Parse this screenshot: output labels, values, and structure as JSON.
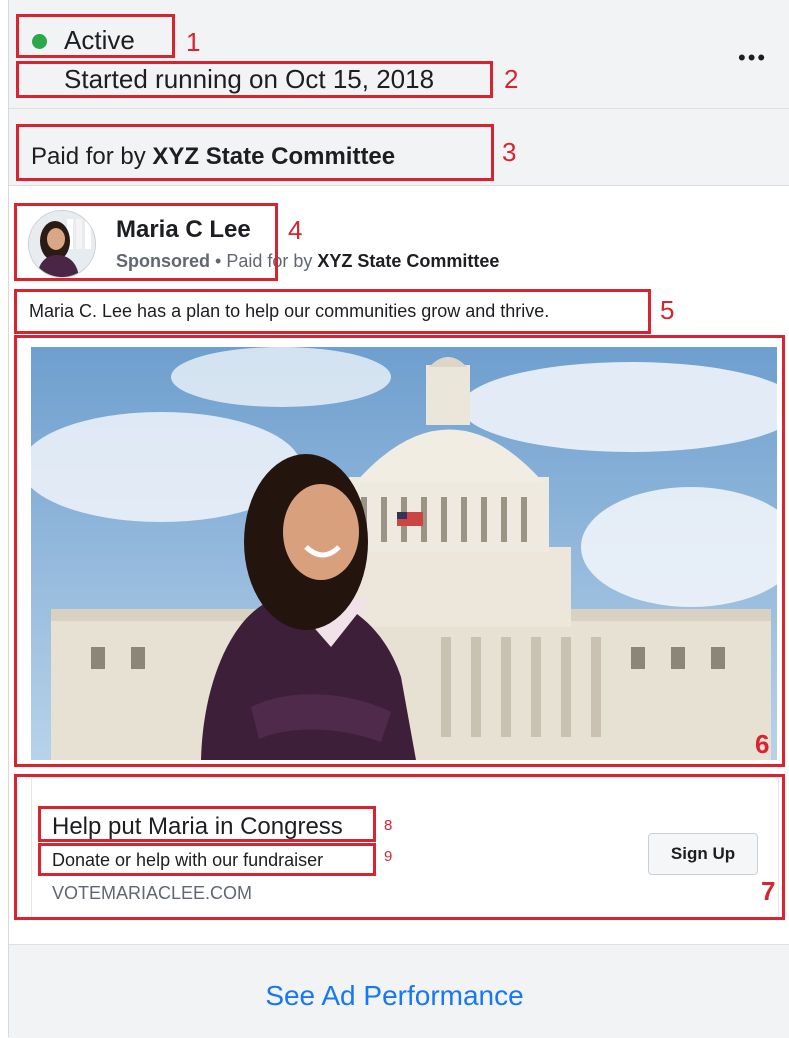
{
  "status": {
    "label": "Active",
    "color": "#2ba84a"
  },
  "started": "Started running on Oct 15, 2018",
  "more_icon": "more-horizontal-icon",
  "paid_for": {
    "prefix": "Paid for by ",
    "name": "XYZ State Committee"
  },
  "post": {
    "author": "Maria C Lee",
    "sponsored": "Sponsored",
    "separator": " • Paid for by ",
    "payer": "XYZ State Committee",
    "text": "Maria C. Lee has a plan to help our communities grow and thrive."
  },
  "cta": {
    "headline": "Help put Maria in Congress",
    "description": "Donate or help with our fundraiser",
    "domain": "VOTEMARIACLEE.COM",
    "button": "Sign Up"
  },
  "footer": {
    "link": "See Ad Performance"
  },
  "annotations": [
    "1",
    "2",
    "3",
    "4",
    "5",
    "6",
    "7",
    "8",
    "9"
  ],
  "colors": {
    "annotation": "#d9232e",
    "link": "#1877f2"
  }
}
